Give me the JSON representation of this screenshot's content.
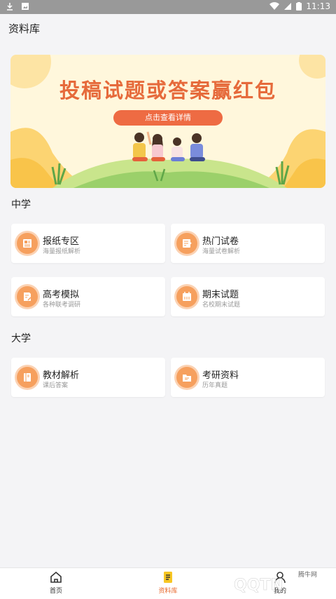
{
  "status_bar": {
    "time": "11:13",
    "icons": [
      "download-icon",
      "photo-icon",
      "wifi-icon",
      "signal-icon",
      "battery-icon"
    ]
  },
  "header": {
    "title": "资料库"
  },
  "banner": {
    "headline": "投稿试题或答案赢红包",
    "cta_label": "点击查看详情"
  },
  "sections": [
    {
      "title": "中学",
      "items": [
        {
          "title": "报纸专区",
          "subtitle": "海量报纸解析",
          "icon": "newspaper-icon"
        },
        {
          "title": "热门试卷",
          "subtitle": "海量试卷解析",
          "icon": "exam-paper-icon"
        },
        {
          "title": "高考模拟",
          "subtitle": "各种联考调研",
          "icon": "mock-exam-icon"
        },
        {
          "title": "期末试题",
          "subtitle": "名校期末试题",
          "icon": "calendar-icon"
        }
      ]
    },
    {
      "title": "大学",
      "items": [
        {
          "title": "教材解析",
          "subtitle": "课后答案",
          "icon": "textbook-icon"
        },
        {
          "title": "考研资料",
          "subtitle": "历年真题",
          "icon": "folder-icon"
        }
      ]
    }
  ],
  "tab_bar": {
    "items": [
      {
        "label": "首页",
        "icon": "home-icon",
        "active": false
      },
      {
        "label": "资料库",
        "icon": "library-icon",
        "active": true
      },
      {
        "label": "我的",
        "icon": "profile-icon",
        "active": false
      }
    ]
  },
  "watermark": {
    "brand": "QQTN.com",
    "text": "腾牛网"
  },
  "colors": {
    "accent": "#e86a2e",
    "banner_bg": "#fff7dc",
    "icon_bg": "#f6a05e"
  }
}
